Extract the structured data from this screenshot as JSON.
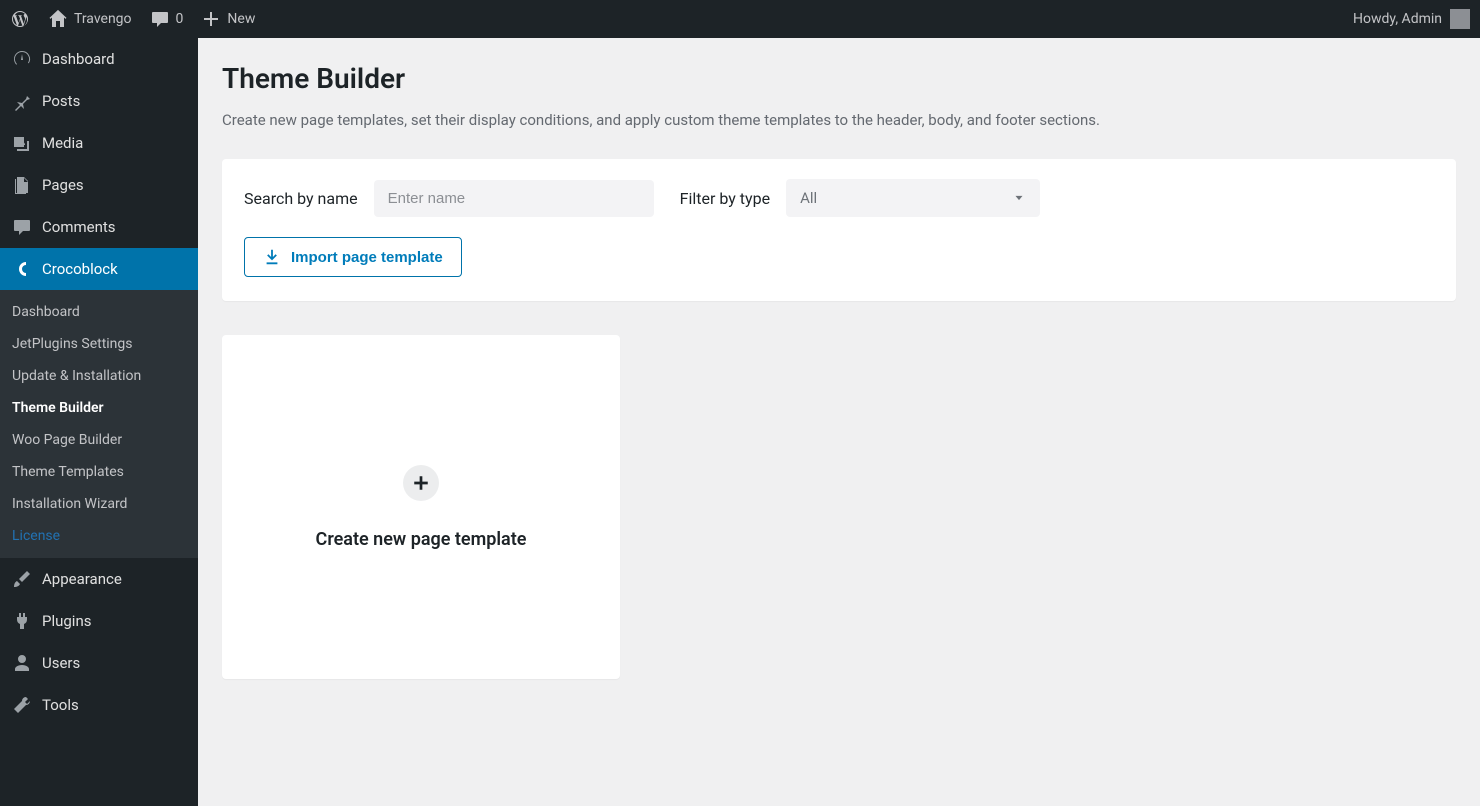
{
  "adminbar": {
    "site_name": "Travengo",
    "comments_count": "0",
    "new_label": "New",
    "greeting": "Howdy, Admin"
  },
  "sidebar": {
    "items": [
      {
        "label": "Dashboard",
        "icon": "dashboard"
      },
      {
        "label": "Posts",
        "icon": "pin"
      },
      {
        "label": "Media",
        "icon": "media"
      },
      {
        "label": "Pages",
        "icon": "pages"
      },
      {
        "label": "Comments",
        "icon": "comment"
      },
      {
        "label": "Crocoblock",
        "icon": "croco",
        "active": true
      },
      {
        "label": "Appearance",
        "icon": "brush"
      },
      {
        "label": "Plugins",
        "icon": "plug"
      },
      {
        "label": "Users",
        "icon": "user"
      },
      {
        "label": "Tools",
        "icon": "wrench"
      }
    ],
    "submenu": [
      {
        "label": "Dashboard"
      },
      {
        "label": "JetPlugins Settings"
      },
      {
        "label": "Update & Installation"
      },
      {
        "label": "Theme Builder",
        "current": true
      },
      {
        "label": "Woo Page Builder"
      },
      {
        "label": "Theme Templates"
      },
      {
        "label": "Installation Wizard"
      },
      {
        "label": "License",
        "license": true
      }
    ]
  },
  "page": {
    "title": "Theme Builder",
    "description": "Create new page templates, set their display conditions, and apply custom theme templates to the header, body, and footer sections."
  },
  "filters": {
    "search_label": "Search by name",
    "search_placeholder": "Enter name",
    "type_label": "Filter by type",
    "type_value": "All",
    "import_label": "Import page template"
  },
  "card": {
    "create_label": "Create new page template"
  }
}
